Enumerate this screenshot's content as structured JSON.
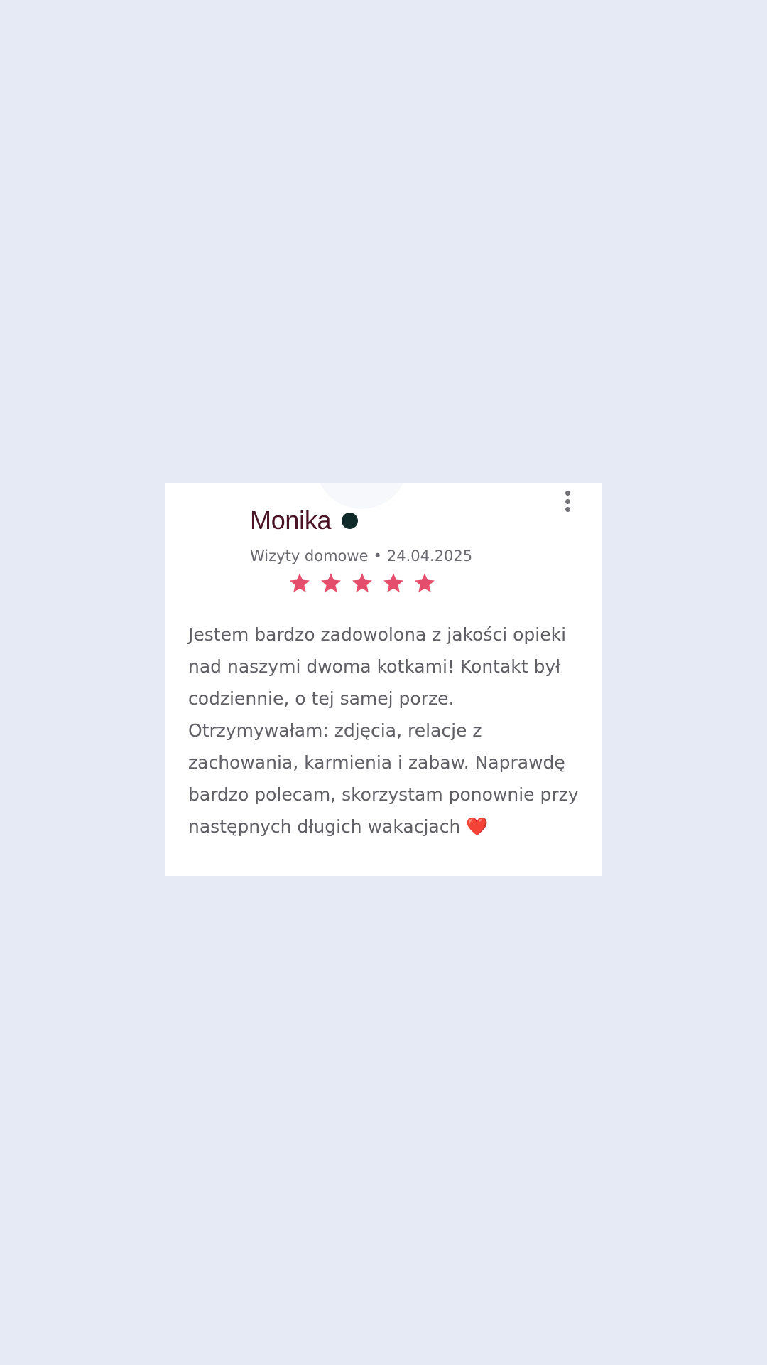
{
  "review": {
    "name": "Monika",
    "service": "Wizyty domowe",
    "separator": "•",
    "date": "24.04.2025",
    "rating": 5,
    "rating_max": 5,
    "text": "Jestem bardzo zadowolona z jakości opieki nad naszymi dwoma kotkami! Kontakt był codziennie, o tej samej porze. Otrzymywałam: zdjęcia, relacje z zachowania, karmienia i zabaw. Naprawdę bardzo polecam, skorzystam ponownie przy następnych długich wakacjach",
    "text_emoji": "❤️"
  },
  "colors": {
    "background": "#e6eaf5",
    "card": "#ffffff",
    "name": "#4b1426",
    "star": "#e44d6c",
    "status_dot": "#102a2a",
    "text": "#5f5f65"
  },
  "icons": {
    "menu": "more-vertical-icon",
    "rating": "star-icon",
    "status": "status-dot-icon"
  }
}
